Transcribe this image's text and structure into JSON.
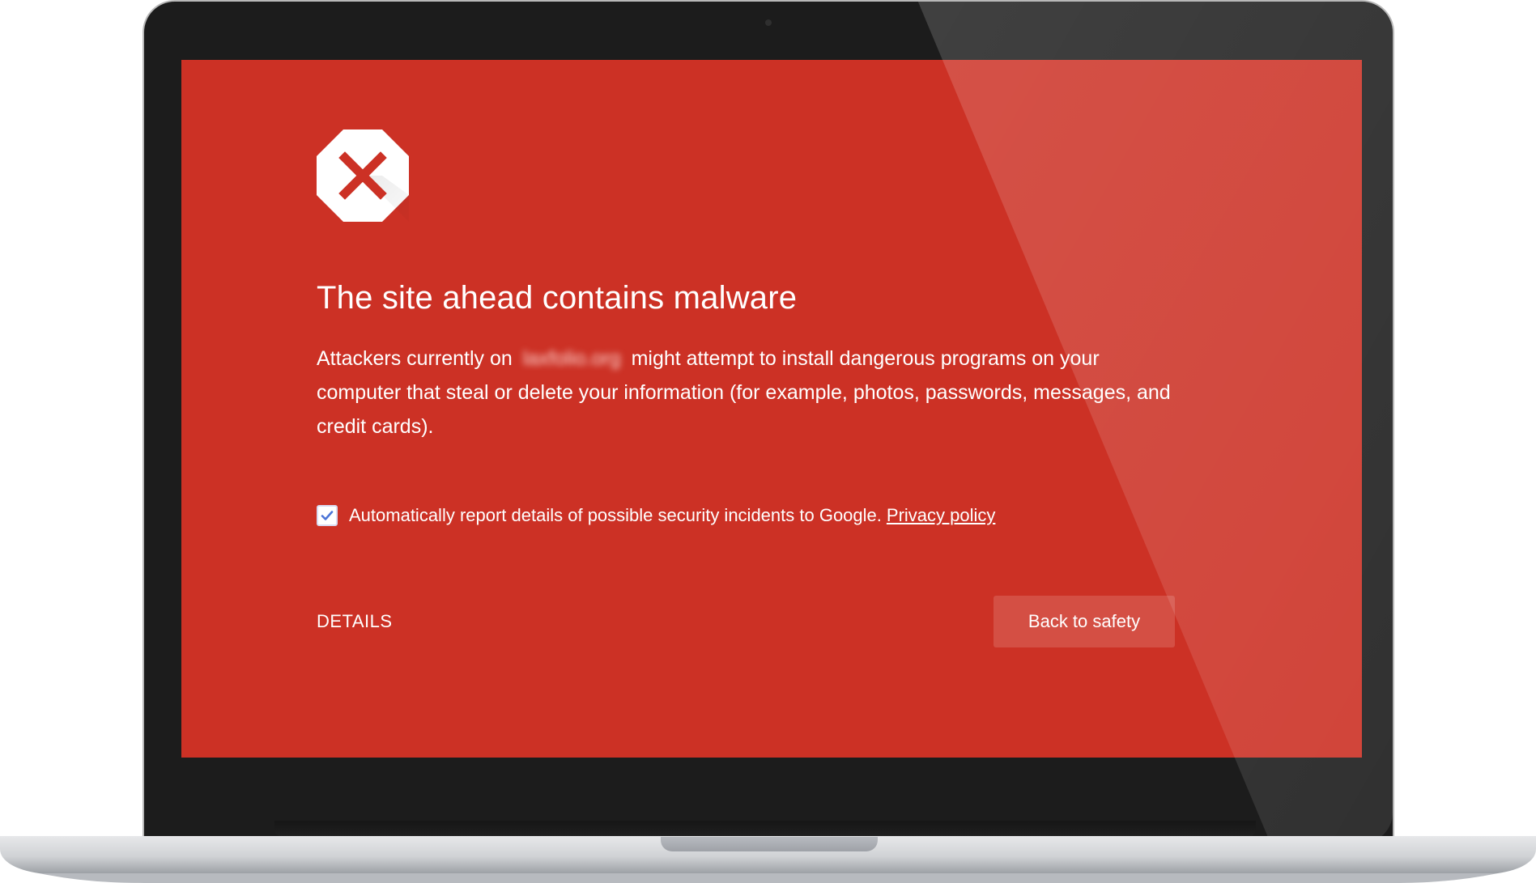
{
  "page": {
    "title": "The site ahead contains malware",
    "description": {
      "prefix": "Attackers currently on",
      "domain": "laxfolio.org",
      "suffix": "might attempt to install dangerous programs on your computer that steal or delete your information (for example, photos, passwords, messages, and credit cards)."
    },
    "report": {
      "checked": true,
      "text": "Automatically report details of possible security incidents to Google.",
      "privacy_label": "Privacy policy"
    },
    "details_label": "DETAILS",
    "safety_label": "Back to safety"
  },
  "icons": {
    "warning": "stop-icon",
    "checkbox": "checkbox-check-icon"
  },
  "colors": {
    "screen": "#cc3125",
    "button": "#d44f44",
    "bezel": "#1c1c1c",
    "base": "#d8d9db"
  }
}
